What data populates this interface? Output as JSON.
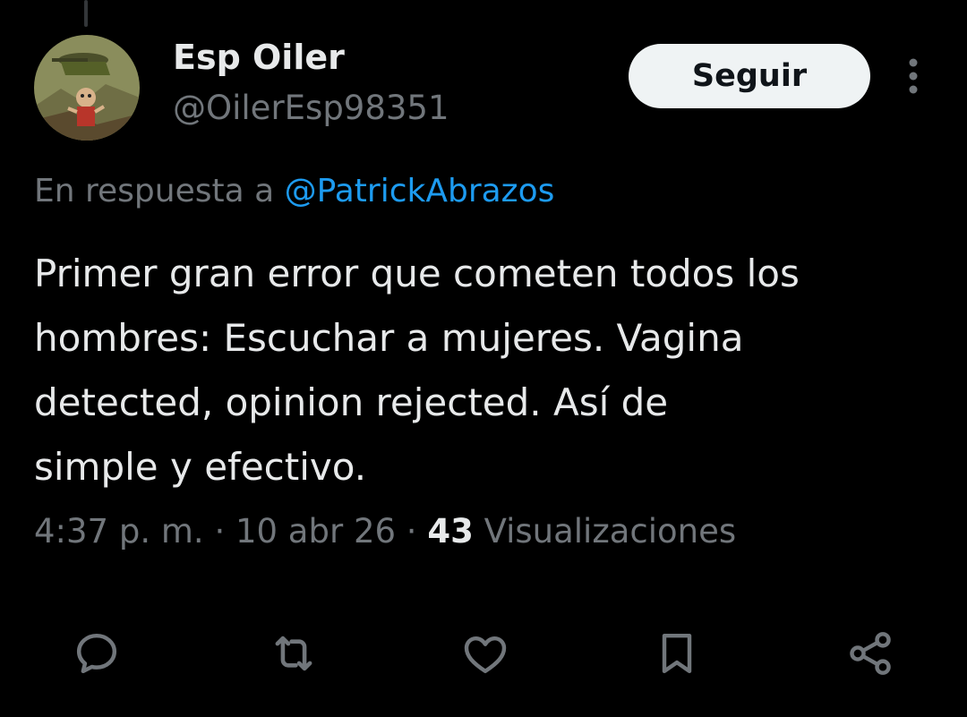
{
  "tweet": {
    "author": {
      "display_name": "Esp Oiler",
      "handle": "@OilerEsp98351"
    },
    "follow_label": "Seguir",
    "reply_prefix": "En respuesta a",
    "reply_to": "@PatrickAbrazos",
    "text_lines": [
      "Primer gran error que cometen todos los",
      "hombres: Escuchar a mujeres. Vagina",
      "detected, opinion rejected. Así de",
      "simple y efectivo."
    ],
    "time": "4:37 p. m.",
    "date": "10 abr 26",
    "separator": "·",
    "views_count": "43",
    "views_label": "Visualizaciones"
  },
  "actions": [
    {
      "name": "reply",
      "icon": "comment-icon"
    },
    {
      "name": "repost",
      "icon": "repost-icon"
    },
    {
      "name": "like",
      "icon": "heart-icon"
    },
    {
      "name": "bookmark",
      "icon": "bookmark-icon"
    },
    {
      "name": "share",
      "icon": "share-icon"
    }
  ],
  "colors": {
    "background": "#000000",
    "text_primary": "#e7e9ea",
    "text_secondary": "#71767b",
    "link": "#1d9bf0",
    "button_bg": "#eff3f4"
  }
}
